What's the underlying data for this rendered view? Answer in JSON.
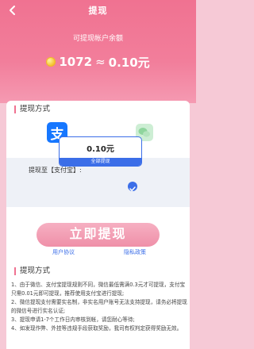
{
  "header": {
    "title": "提现",
    "back_icon": "chevron-left-icon"
  },
  "balance": {
    "label": "可提现帐户余额",
    "coins": "1072",
    "approx": "≈",
    "money": "0.10元",
    "coin_icon": "gold-coin-icon"
  },
  "methods": {
    "section_title": "提现方式",
    "options": [
      {
        "name": "alipay",
        "icon": "alipay-icon",
        "glyph": "支",
        "selected": true
      },
      {
        "name": "wechat",
        "icon": "wechat-icon",
        "selected": false
      }
    ],
    "account_label": "提现至【支付宝】:",
    "amount": "0.10元",
    "amount_sub": "全部提现",
    "withdraw_button": "立即提现",
    "user_agreement": "用户协议",
    "privacy_policy": "隐私政策"
  },
  "rules": {
    "section_title": "提现方式",
    "lines": [
      "1、由于微信、支付宝提现规则不同，微信最低需满0.3元才可提现，支付宝只需0.01元即可提现，推荐使用支付宝进行提现;",
      "2、微信提现支付需要实名制，非实名用户账号无法支持提现，请务必将提现的微信号进行实名认证;",
      "3、提现申请1-7个工作日内审核到帐，请您耐心等待;",
      "4、如发现作弊、外挂等违规手段获取奖励，我司有权判定获得奖励无效。"
    ]
  },
  "colors": {
    "header": "#f07291",
    "accent_blue": "#3b6ee8",
    "page_bg": "#f6c9d6"
  }
}
